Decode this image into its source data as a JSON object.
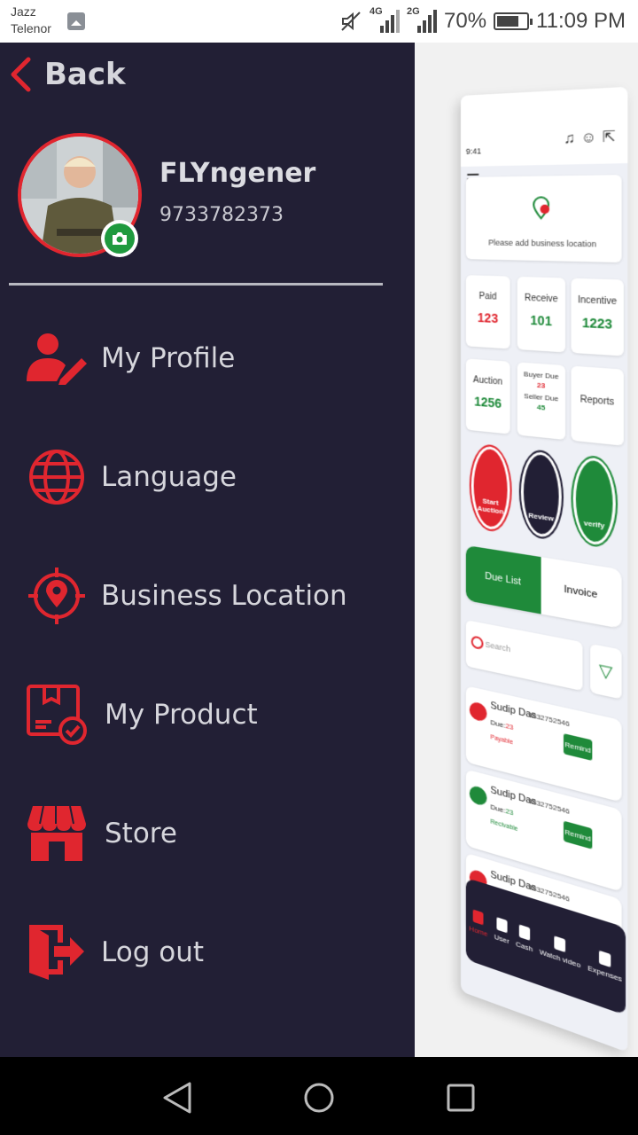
{
  "status_bar": {
    "carrier_line1": "Jazz",
    "carrier_line2": "Telenor",
    "net1": "4G",
    "net2": "2G",
    "battery": "70%",
    "time": "11:09 PM"
  },
  "drawer": {
    "back_label": "Back",
    "user": {
      "name": "FLYngener",
      "phone": "9733782373"
    },
    "menu": [
      {
        "label": "My Profile",
        "icon": "user-edit-icon"
      },
      {
        "label": "Language",
        "icon": "globe-icon"
      },
      {
        "label": "Business Location",
        "icon": "location-target-icon"
      },
      {
        "label": "My Product",
        "icon": "product-box-icon"
      },
      {
        "label": "Store",
        "icon": "store-icon"
      },
      {
        "label": "Log out",
        "icon": "logout-icon"
      }
    ]
  },
  "preview": {
    "time": "9:41",
    "location_prompt": "Please add business location",
    "stats": [
      {
        "label": "Paid",
        "value": "123"
      },
      {
        "label": "Receive",
        "value": "101"
      },
      {
        "label": "Incentive",
        "value": "1223"
      },
      {
        "label": "Auction",
        "value": "1256"
      },
      {
        "label": "Buyer Due",
        "value": "23"
      },
      {
        "label": "Seller Due",
        "value": "45"
      },
      {
        "label": "Reports",
        "value": ""
      }
    ],
    "actions": [
      "Start Auction",
      "Review",
      "verify"
    ],
    "tabs": [
      "Due List",
      "Invoice"
    ],
    "search_placeholder": "Search",
    "rows": [
      {
        "name": "Sudip Das",
        "phone": "9832752546",
        "due_label": "Due:",
        "due": "23",
        "type": "Payable",
        "button": "Remind"
      },
      {
        "name": "Sudip Das",
        "phone": "9832752546",
        "due_label": "Due:",
        "due": "23",
        "type": "Recivable",
        "button": "Remind"
      },
      {
        "name": "Sudip Das",
        "phone": "9832752546",
        "due_label": "",
        "due": "",
        "type": "",
        "button": "Remind"
      }
    ],
    "bottom_nav": [
      "Home",
      "User",
      "Cash",
      "Watch video",
      "Expenses"
    ]
  },
  "colors": {
    "accent": "#e0262f",
    "drawer_bg": "#221f35",
    "green": "#1f8a3a"
  }
}
